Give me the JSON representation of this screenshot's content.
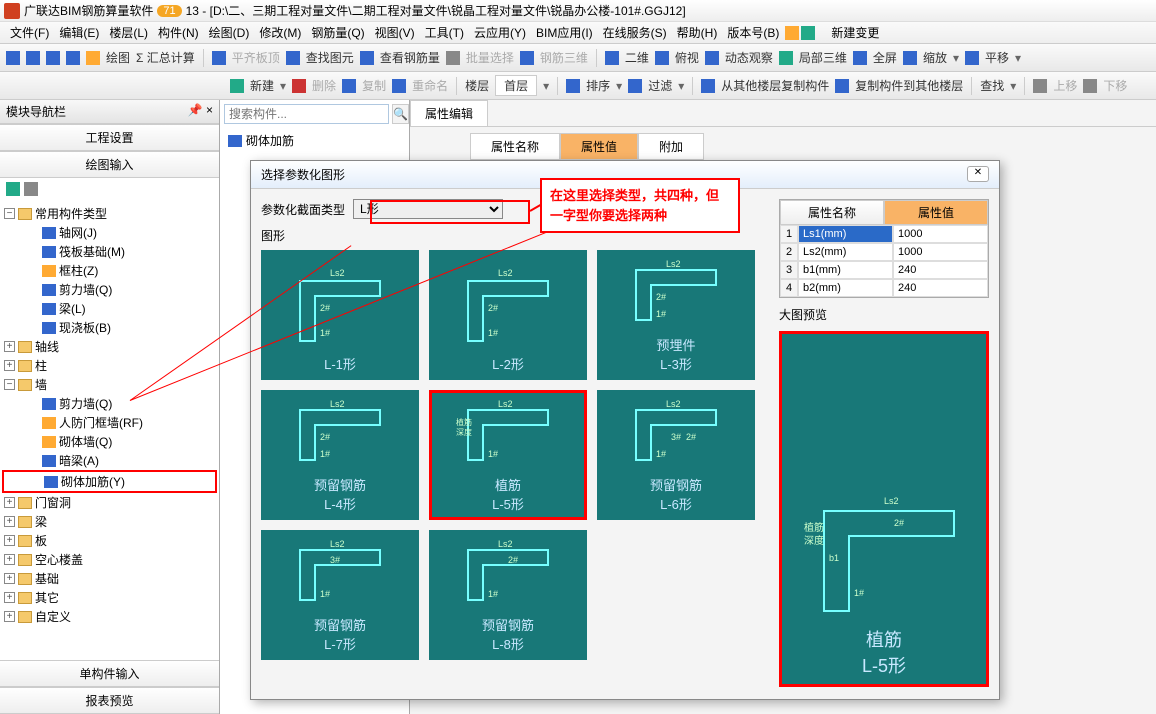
{
  "title_prefix": "广联达BIM钢筋算量软件",
  "title_badge": "71",
  "title_suffix": "13 - [D:\\二、三期工程对量文件\\二期工程对量文件\\锐晶工程对量文件\\锐晶办公楼-101#.GGJ12]",
  "menus": [
    "文件(F)",
    "编辑(E)",
    "楼层(L)",
    "构件(N)",
    "绘图(D)",
    "修改(M)",
    "钢筋量(Q)",
    "视图(V)",
    "工具(T)",
    "云应用(Y)",
    "BIM应用(I)",
    "在线服务(S)",
    "帮助(H)",
    "版本号(B)"
  ],
  "new_change": "新建变更",
  "toolbar1": {
    "draw": "绘图",
    "sum": "Σ 汇总计算",
    "flat_top": "平齐板顶",
    "find_elem": "查找图元",
    "view_rebar": "查看钢筋量",
    "batch_select": "批量选择",
    "rebar_3d": "钢筋三维",
    "view2d": "二维",
    "top_view": "俯视",
    "dyn_obs": "动态观察",
    "local_3d": "局部三维",
    "fullscreen": "全屏",
    "zoom": "缩放",
    "pan": "平移"
  },
  "toolbar2": {
    "new": "新建",
    "delete": "删除",
    "copy": "复制",
    "rename": "重命名",
    "floor": "楼层",
    "first_floor": "首层",
    "sort": "排序",
    "filter": "过滤",
    "copy_from": "从其他楼层复制构件",
    "copy_to": "复制构件到其他楼层",
    "find": "查找",
    "up": "上移",
    "down": "下移"
  },
  "nav_header": "模块导航栏",
  "proj_settings": "工程设置",
  "draw_input": "绘图输入",
  "tree": {
    "root": "常用构件类型",
    "children1": [
      "轴网(J)",
      "筏板基础(M)",
      "框柱(Z)",
      "剪力墙(Q)",
      "梁(L)",
      "现浇板(B)"
    ],
    "axis": "轴线",
    "column": "柱",
    "wall": "墙",
    "wall_children": [
      "剪力墙(Q)",
      "人防门框墙(RF)",
      "砌体墙(Q)",
      "暗梁(A)",
      "砌体加筋(Y)"
    ],
    "door_win": "门窗洞",
    "beam": "梁",
    "slab": "板",
    "hollow": "空心楼盖",
    "found": "基础",
    "other": "其它",
    "custom": "自定义"
  },
  "single_input": "单构件输入",
  "report_preview": "报表预览",
  "search_placeholder": "搜索构件...",
  "current_item": "砌体加筋",
  "prop_edit_tab": "属性编辑",
  "prop_cols": {
    "name": "属性名称",
    "value": "属性值",
    "extra": "附加"
  },
  "dialog": {
    "title": "选择参数化图形",
    "param_label": "参数化截面类型",
    "param_value": "L形",
    "shapes_section": "图形",
    "shapes": [
      "L-1形",
      "L-2形",
      "预埋件\nL-3形",
      "预留钢筋\nL-4形",
      "植筋\nL-5形",
      "预留钢筋\nL-6形",
      "预留钢筋\nL-7形",
      "预留钢筋\nL-8形"
    ],
    "prop_rows": [
      {
        "idx": "1",
        "name": "Ls1(mm)",
        "val": "1000"
      },
      {
        "idx": "2",
        "name": "Ls2(mm)",
        "val": "1000"
      },
      {
        "idx": "3",
        "name": "b1(mm)",
        "val": "240"
      },
      {
        "idx": "4",
        "name": "b2(mm)",
        "val": "240"
      }
    ],
    "preview_title": "大图预览",
    "preview_label": "植筋\nL-5形"
  },
  "callout": "在这里选择类型，共四种，但一字型你要选择两种"
}
